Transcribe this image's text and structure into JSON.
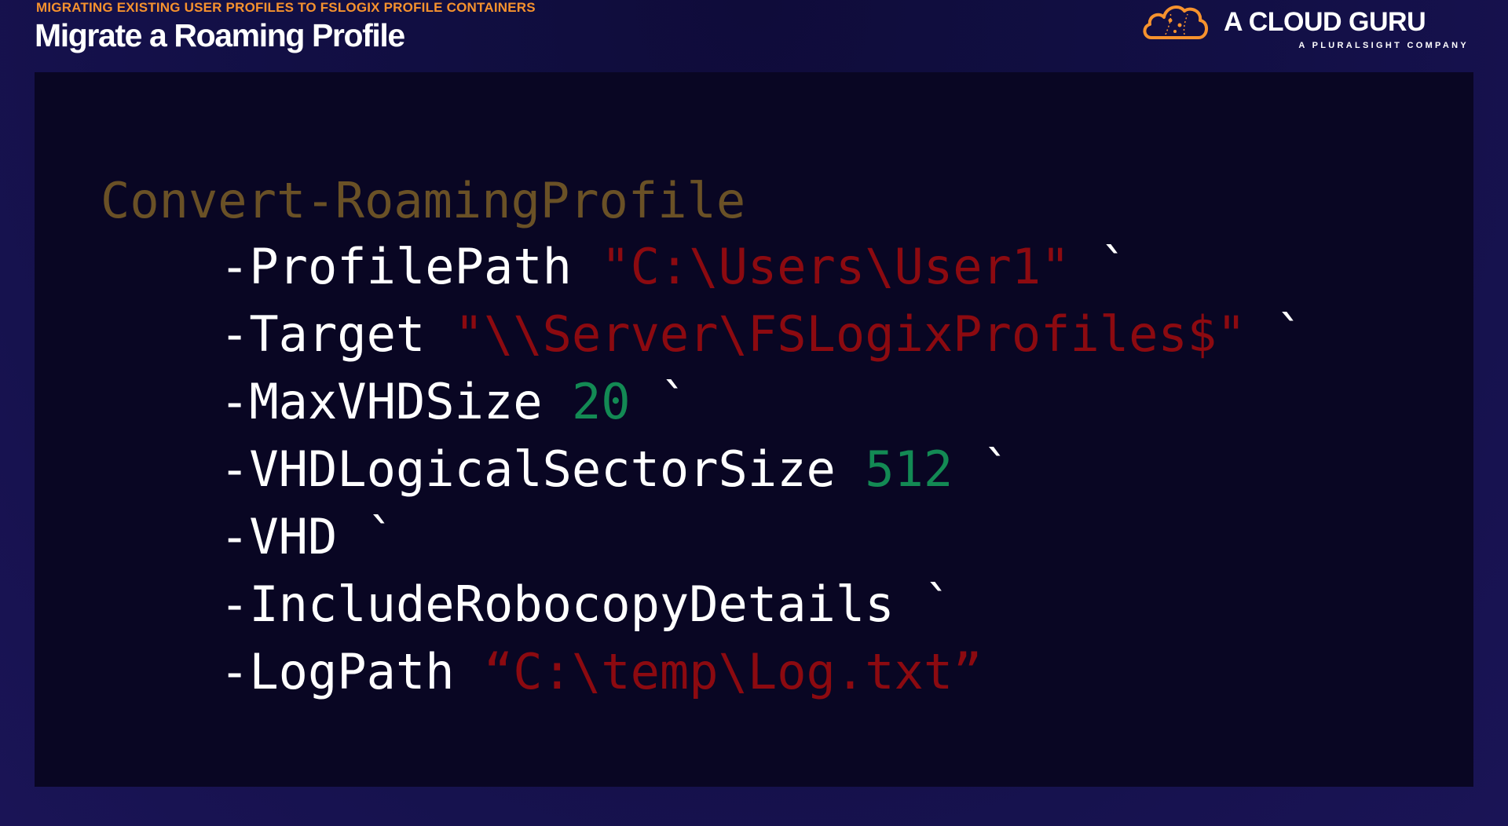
{
  "header": {
    "eyebrow": "MIGRATING EXISTING USER PROFILES TO FSLOGIX PROFILE CONTAINERS",
    "title": "Migrate a Roaming Profile"
  },
  "brand": {
    "name": "A CLOUD GURU",
    "tagline": "A PLURALSIGHT COMPANY",
    "icon": "cloud-icon",
    "accent_color": "#f6922e"
  },
  "code": {
    "cmdlet": "Convert-RoamingProfile",
    "lines": [
      {
        "flag": "-ProfilePath",
        "value": "\"C:\\Users\\User1\"",
        "value_type": "string",
        "continuation": "`"
      },
      {
        "flag": "-Target",
        "value": "\"\\\\Server\\FSLogixProfiles$\"",
        "value_type": "string",
        "continuation": "`"
      },
      {
        "flag": "-MaxVHDSize",
        "value": "20",
        "value_type": "number",
        "continuation": "`"
      },
      {
        "flag": "-VHDLogicalSectorSize",
        "value": "512",
        "value_type": "number",
        "continuation": "`"
      },
      {
        "flag": "-VHD",
        "value": "",
        "value_type": "none",
        "continuation": "`"
      },
      {
        "flag": "-IncludeRobocopyDetails",
        "value": "",
        "value_type": "none",
        "continuation": "`"
      },
      {
        "flag": "-LogPath",
        "value": "“C:\\temp\\Log.txt”",
        "value_type": "string",
        "continuation": ""
      }
    ]
  },
  "colors": {
    "cmdlet": "#6a5126",
    "string": "#8c0a10",
    "number": "#138a54",
    "flag": "#ffffff",
    "panel_background": "#090623"
  }
}
